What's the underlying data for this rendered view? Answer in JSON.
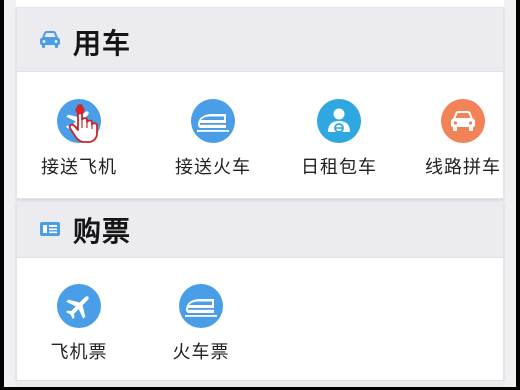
{
  "sections": [
    {
      "title": "用车",
      "icon": "car-icon",
      "items": [
        {
          "label": "接送飞机",
          "icon": "airplane-icon",
          "color": "#4a9ee8"
        },
        {
          "label": "接送火车",
          "icon": "train-icon",
          "color": "#4a9ee8"
        },
        {
          "label": "日租包车",
          "icon": "driver-icon",
          "color": "#2fa7e0"
        },
        {
          "label": "线路拼车",
          "icon": "car-icon",
          "color": "#f28257"
        }
      ]
    },
    {
      "title": "购票",
      "icon": "ticket-icon",
      "items": [
        {
          "label": "飞机票",
          "icon": "airplane-icon",
          "color": "#4a9ee8"
        },
        {
          "label": "火车票",
          "icon": "train-icon",
          "color": "#4a9ee8"
        }
      ]
    }
  ],
  "colors": {
    "accent_blue": "#4a9ee8",
    "accent_orange": "#f28257",
    "header_bg": "#ececf0",
    "cursor_red": "#d6262b"
  }
}
